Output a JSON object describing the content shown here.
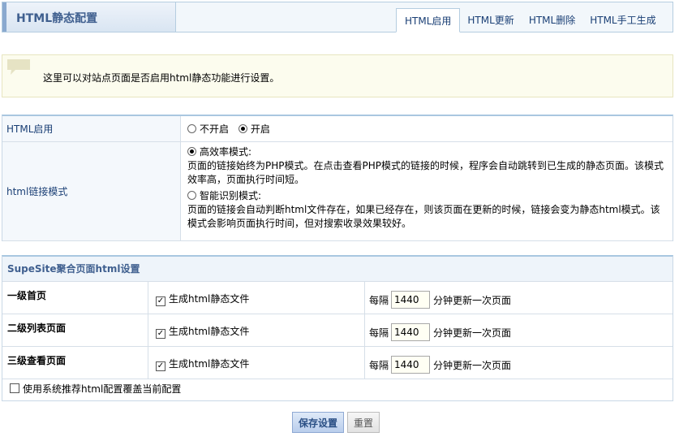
{
  "header": {
    "title": "HTML静态配置",
    "tabs": [
      {
        "label": "HTML启用",
        "active": true
      },
      {
        "label": "HTML更新",
        "active": false
      },
      {
        "label": "HTML删除",
        "active": false
      },
      {
        "label": "HTML手工生成",
        "active": false
      }
    ]
  },
  "info": {
    "icon": "speech-bubble-icon",
    "text": "这里可以对站点页面是否启用html静态功能进行设置。"
  },
  "settings": {
    "enable": {
      "label": "HTML启用",
      "options": [
        {
          "label": "不开启",
          "selected": false
        },
        {
          "label": "开启",
          "selected": true
        }
      ]
    },
    "link_mode": {
      "label": "html链接模式",
      "options": [
        {
          "label": "高效率模式:",
          "selected": true,
          "desc": "页面的链接始终为PHP模式。在点击查看PHP模式的链接的时候，程序会自动跳转到已生成的静态页面。该模式效率高，页面执行时间短。"
        },
        {
          "label": "智能识别模式:",
          "selected": false,
          "desc": "页面的链接会自动判断html文件存在，如果已经存在，则该页面在更新的时候，链接会变为静态html模式。该模式会影响页面执行时间，但对搜索收录效果较好。"
        }
      ]
    }
  },
  "aggregate": {
    "title": "SupeSite聚合页面html设置",
    "rows": [
      {
        "name": "一级首页",
        "checkbox_label": "生成html静态文件",
        "checked": true,
        "interval_prefix": "每隔",
        "interval": "1440",
        "interval_suffix": "分钟更新一次页面"
      },
      {
        "name": "二级列表页面",
        "checkbox_label": "生成html静态文件",
        "checked": true,
        "interval_prefix": "每隔",
        "interval": "1440",
        "interval_suffix": "分钟更新一次页面"
      },
      {
        "name": "三级查看页面",
        "checkbox_label": "生成html静态文件",
        "checked": true,
        "interval_prefix": "每隔",
        "interval": "1440",
        "interval_suffix": "分钟更新一次页面"
      }
    ],
    "override": {
      "label": "使用系统推荐html配置覆盖当前配置",
      "checked": false
    }
  },
  "buttons": {
    "save": "保存设置",
    "reset": "重置"
  }
}
